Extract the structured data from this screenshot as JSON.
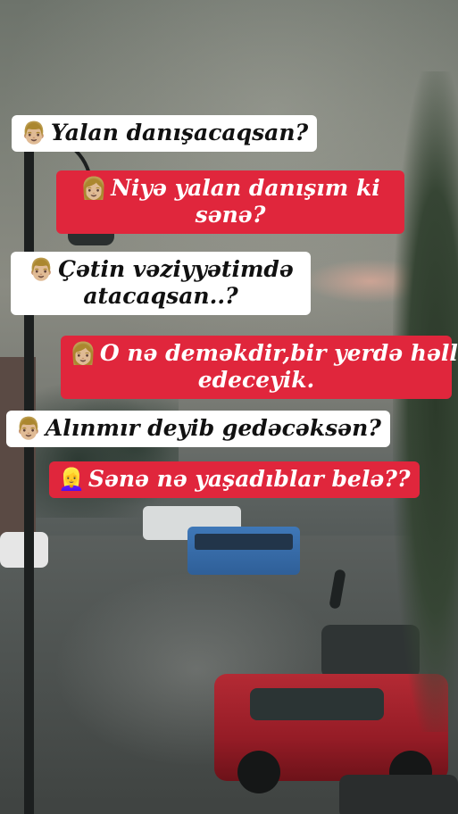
{
  "messages": [
    {
      "side": "left",
      "style": "white",
      "emoji": "👨🏼",
      "lines": [
        "Yalan danışacaqsan?"
      ]
    },
    {
      "side": "right",
      "style": "red",
      "emoji": "👩🏼",
      "lines": [
        "Niyə yalan danışım ki",
        "sənə?"
      ]
    },
    {
      "side": "left",
      "style": "white",
      "emoji": "👨🏼",
      "lines": [
        "Çətin vəziyyətimdə",
        "atacaqsan..?"
      ]
    },
    {
      "side": "right",
      "style": "red",
      "emoji": "👩🏼",
      "lines": [
        "O nə deməkdir,bir yerdə həll",
        "edeceyik."
      ]
    },
    {
      "side": "left",
      "style": "white",
      "emoji": "👨🏼",
      "lines": [
        "Alınmır deyib gedəcəksən?"
      ]
    },
    {
      "side": "right",
      "style": "red",
      "emoji": "👱‍♀️",
      "lines": [
        "Sənə nə yaşadıblar belə??"
      ]
    }
  ],
  "colors": {
    "red_bubble": "#e0263c",
    "white_bubble": "#ffffff"
  }
}
